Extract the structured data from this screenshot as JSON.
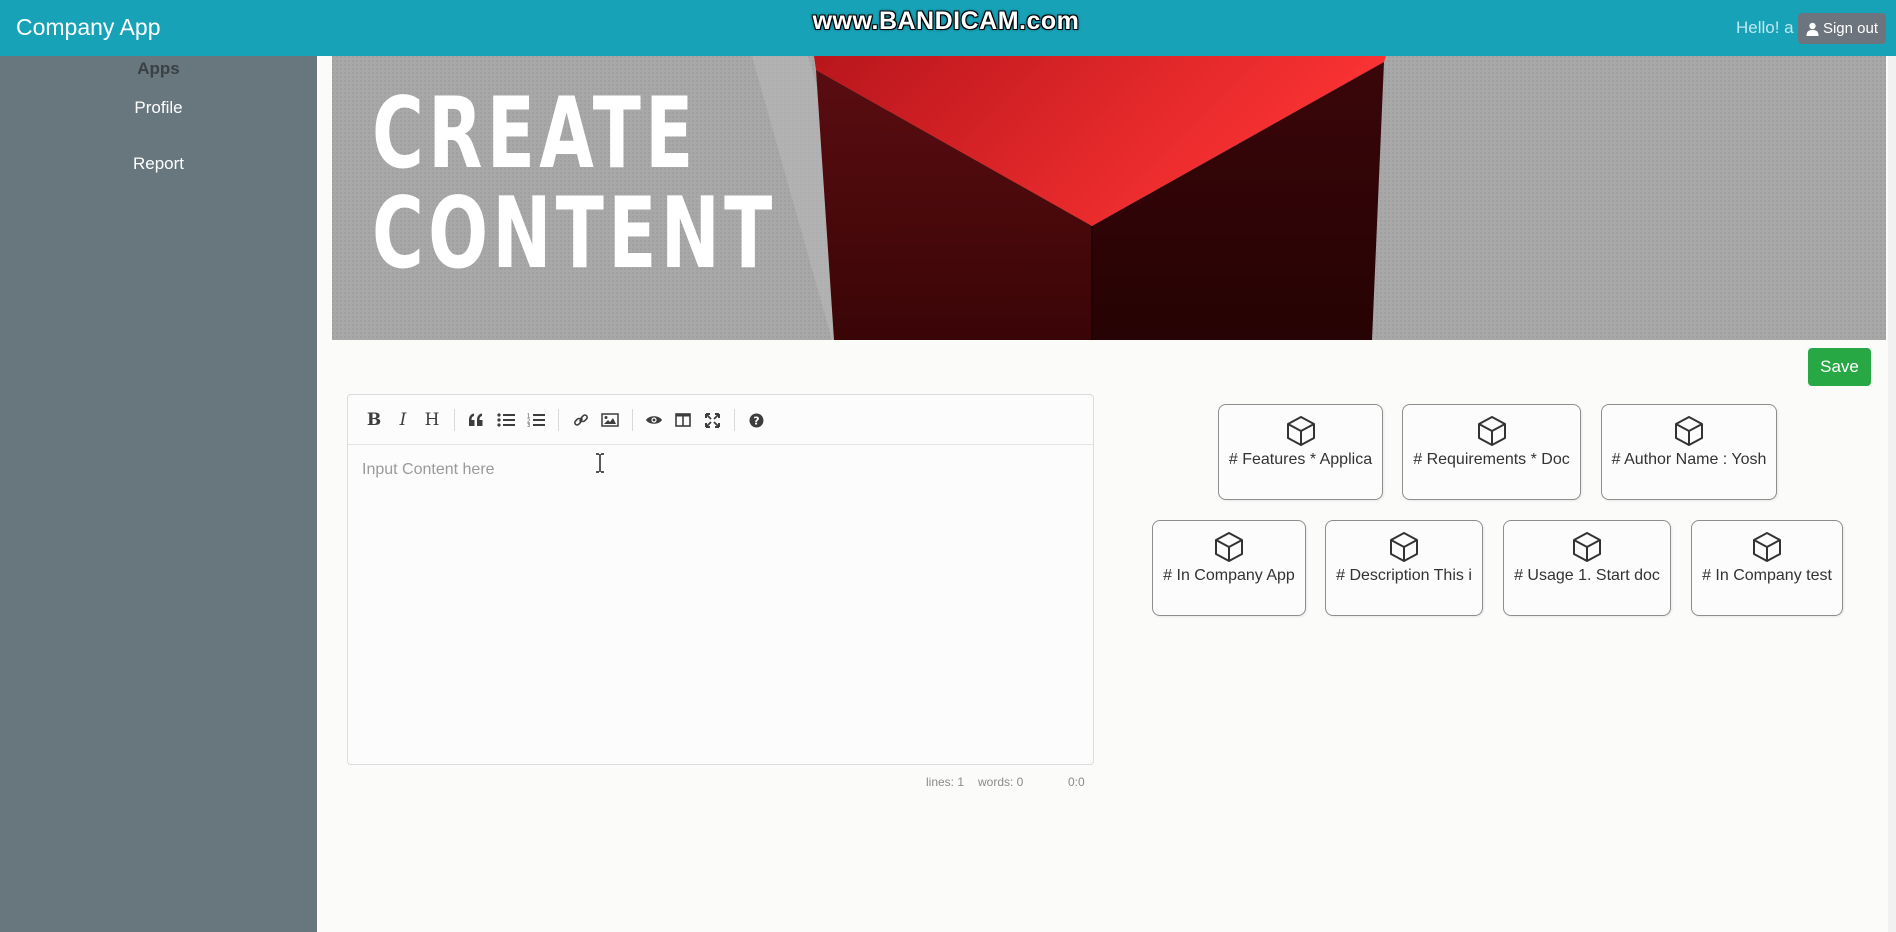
{
  "header": {
    "brand": "Company App",
    "watermark": "www.BANDICAM.com",
    "greeting": "Hello! a",
    "signout_label": "Sign out"
  },
  "sidebar": {
    "heading": "Apps",
    "items": [
      {
        "label": "Profile"
      },
      {
        "label": "Report"
      }
    ]
  },
  "banner": {
    "line1": "CREATE",
    "line2": "CONTENT"
  },
  "actions": {
    "save_label": "Save"
  },
  "editor": {
    "toolbar": [
      "bold-icon",
      "italic-icon",
      "heading-icon",
      "quote-icon",
      "unordered-list-icon",
      "ordered-list-icon",
      "link-icon",
      "image-icon",
      "preview-icon",
      "side-by-side-icon",
      "fullscreen-icon",
      "help-icon"
    ],
    "placeholder": "Input Content here",
    "status": {
      "lines": "lines: 1",
      "words": "words: 0",
      "cursor": "0:0"
    }
  },
  "templates": [
    {
      "label": "# Features * Applica"
    },
    {
      "label": "# Requirements * Doc"
    },
    {
      "label": "# Author Name : Yosh"
    },
    {
      "label": "# In Company App"
    },
    {
      "label": "# Description This i"
    },
    {
      "label": "# Usage 1. Start doc"
    },
    {
      "label": "# In Company test"
    }
  ],
  "colors": {
    "header": "#17a2b8",
    "sidebar": "#68777e",
    "save": "#28a745",
    "signout": "#6c757d"
  }
}
